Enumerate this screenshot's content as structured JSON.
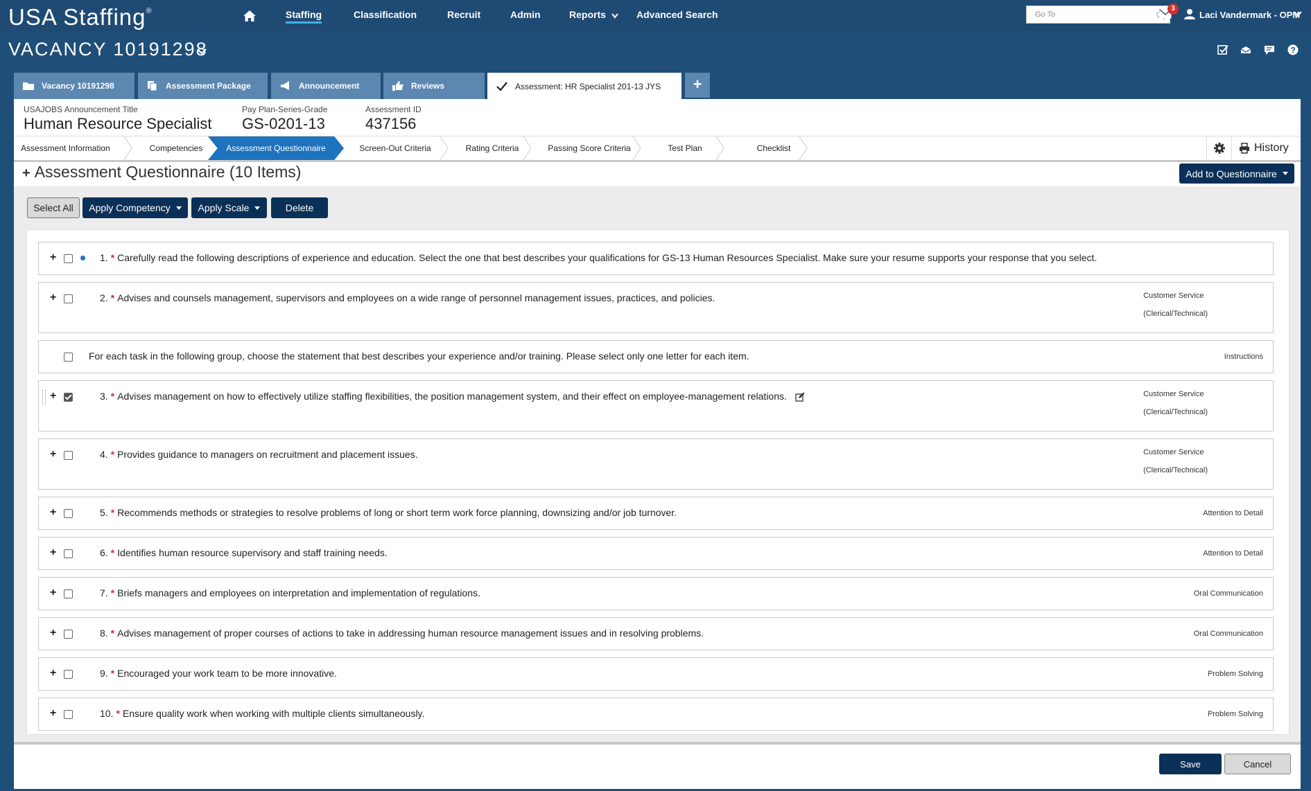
{
  "app": {
    "logo_text": "USA Staffing",
    "logo_mark": "®"
  },
  "nav": {
    "items": [
      {
        "label": "Staffing",
        "active": true
      },
      {
        "label": "Classification"
      },
      {
        "label": "Recruit"
      },
      {
        "label": "Admin"
      },
      {
        "label": "Reports"
      },
      {
        "label": "Advanced Search"
      }
    ],
    "goto_placeholder": "Go To",
    "mail_badge": "3",
    "user_name": "Laci Vandermark - OPM"
  },
  "vacancy": {
    "title": "VACANCY 10191298"
  },
  "tabs": [
    {
      "label": "Vacancy 10191298",
      "icon": "folder-icon"
    },
    {
      "label": "Assessment Package",
      "icon": "documents-icon"
    },
    {
      "label": "Announcement",
      "icon": "megaphone-icon"
    },
    {
      "label": "Reviews",
      "icon": "thumbs-up-icon"
    },
    {
      "label": "Assessment: HR Specialist 201-13 JYS",
      "icon": "checkmark-icon",
      "active": true
    }
  ],
  "tab_add_label": "+",
  "info": {
    "title_label": "USAJOBS Announcement Title",
    "title_value": "Human Resource Specialist",
    "grade_label": "Pay Plan-Series-Grade",
    "grade_value": "GS-0201-13",
    "id_label": "Assessment ID",
    "id_value": "437156"
  },
  "subtabs": [
    {
      "label": "Assessment Information"
    },
    {
      "label": "Competencies"
    },
    {
      "label": "Assessment Questionnaire",
      "active": true
    },
    {
      "label": "Screen-Out Criteria"
    },
    {
      "label": "Rating Criteria"
    },
    {
      "label": "Passing Score Criteria"
    },
    {
      "label": "Test Plan"
    },
    {
      "label": "Checklist"
    }
  ],
  "history_label": "History",
  "section": {
    "expand": "+",
    "title": "Assessment Questionnaire (10 Items)",
    "add_button": "Add to Questionnaire"
  },
  "toolbar": {
    "select_all": "Select All",
    "apply_competency": "Apply Competency",
    "apply_scale": "Apply Scale",
    "delete": "Delete"
  },
  "questions": [
    {
      "num": "1.",
      "required": "*",
      "text": "Carefully read the following descriptions of experience and education. Select the one that best describes your qualifications for GS-13 Human Resources Specialist. Make sure your resume supports your response that you select.",
      "tag": "",
      "tag2": "",
      "checked": false,
      "dot": true
    },
    {
      "num": "2.",
      "required": "*",
      "text": "Advises and counsels management, supervisors and employees on a wide range of personnel management issues, practices, and policies.",
      "tag": "Customer Service",
      "tag2": "(Clerical/Technical)",
      "checked": false
    },
    {
      "num": "",
      "required": "",
      "text": "For each task in the following group, choose the statement that best describes your experience and/or training. Please select only one letter for each item.",
      "tag": "Instructions",
      "tag2": "",
      "checked": false,
      "instruction": true
    },
    {
      "num": "3.",
      "required": "*",
      "text": "Advises management on how to effectively utilize staffing flexibilities, the position management system, and their effect on employee-management relations.",
      "tag": "Customer Service",
      "tag2": "(Clerical/Technical)",
      "checked": true,
      "edit": true
    },
    {
      "num": "4.",
      "required": "*",
      "text": "Provides guidance to managers on recruitment and placement issues.",
      "tag": "Customer Service",
      "tag2": "(Clerical/Technical)",
      "checked": false
    },
    {
      "num": "5.",
      "required": "*",
      "text": "Recommends methods or strategies to resolve problems of long or short term work force planning, downsizing and/or job turnover.",
      "tag": "Attention to Detail",
      "tag2": "",
      "checked": false
    },
    {
      "num": "6.",
      "required": "*",
      "text": "Identifies human resource supervisory and staff training needs.",
      "tag": "Attention to Detail",
      "tag2": "",
      "checked": false
    },
    {
      "num": "7.",
      "required": "*",
      "text": "Briefs managers and employees on interpretation and implementation of regulations.",
      "tag": "Oral Communication",
      "tag2": "",
      "checked": false
    },
    {
      "num": "8.",
      "required": "*",
      "text": "Advises management of proper courses of actions to take in addressing human resource management issues and in resolving problems.",
      "tag": "Oral Communication",
      "tag2": "",
      "checked": false
    },
    {
      "num": "9.",
      "required": "*",
      "text": "Encouraged your work team to be more innovative.",
      "tag": "Problem Solving",
      "tag2": "",
      "checked": false
    },
    {
      "num": "10.",
      "required": "*",
      "text": "Ensure quality work when working with multiple clients simultaneously.",
      "tag": "Problem Solving",
      "tag2": "",
      "checked": false
    }
  ],
  "footer": {
    "save": "Save",
    "cancel": "Cancel"
  },
  "colors": {
    "nav_bg": "#1f4a73",
    "tab_bg": "#5b87b0",
    "accent": "#1e73be",
    "button_dark": "#0b3057",
    "required": "#d32f2f"
  }
}
